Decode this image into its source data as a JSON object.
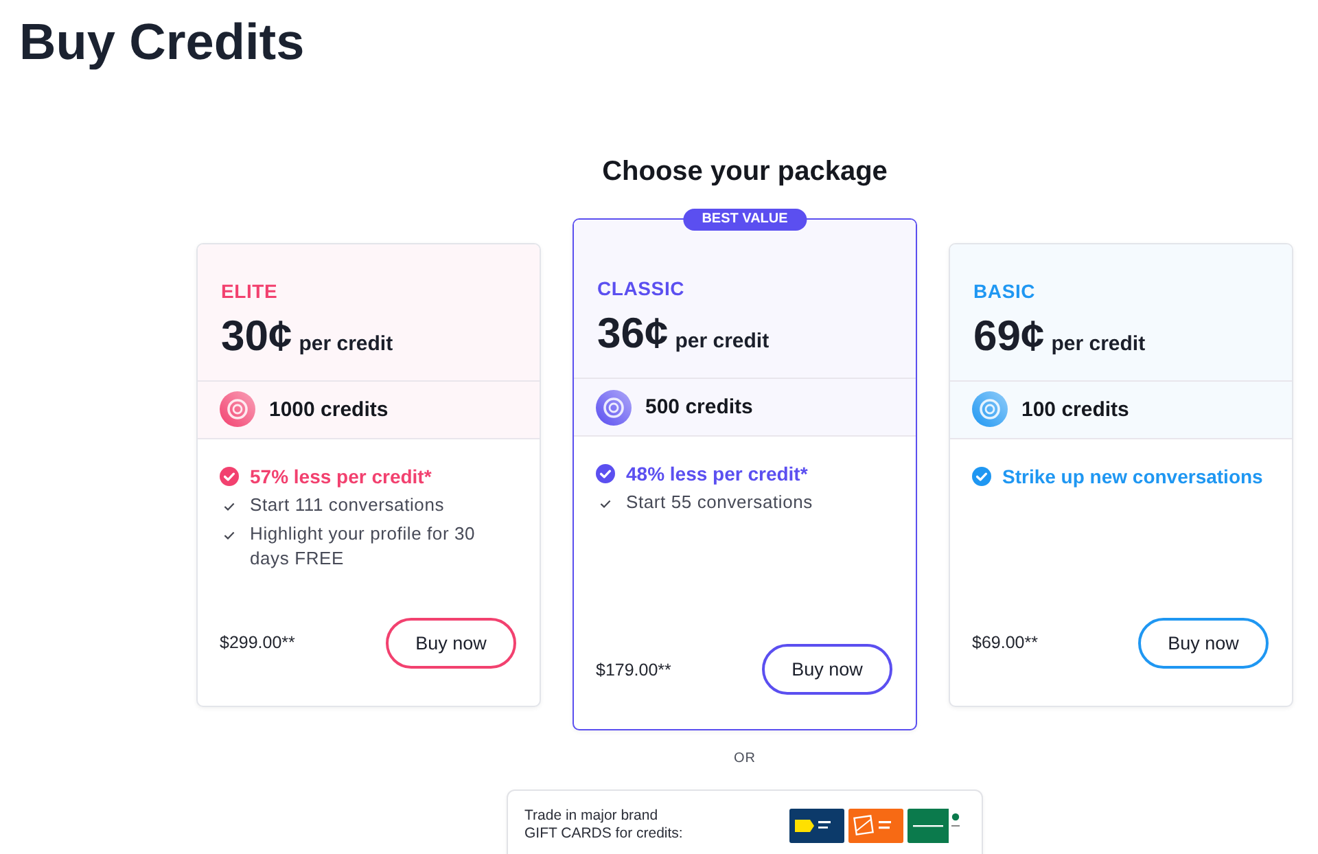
{
  "page": {
    "title": "Buy Credits"
  },
  "heading": "Choose your package",
  "packages": [
    {
      "name": "ELITE",
      "color": "#f2416f",
      "featured": false,
      "price": "30¢",
      "unit": "per credit",
      "credits": "1000 credits",
      "features": [
        {
          "kind": "highlight",
          "text": "57% less per credit*"
        },
        {
          "kind": "plain",
          "text": "Start 111 conversations"
        },
        {
          "kind": "plain",
          "text": "Highlight your profile for 30 days FREE"
        }
      ],
      "total": "$299.00**",
      "button": "Buy now"
    },
    {
      "name": "CLASSIC",
      "color": "#5b4ff0",
      "featured": true,
      "badge": "BEST VALUE",
      "price": "36¢",
      "unit": "per credit",
      "credits": "500 credits",
      "features": [
        {
          "kind": "highlight",
          "text": "48% less per credit*"
        },
        {
          "kind": "plain",
          "text": "Start 55 conversations"
        }
      ],
      "total": "$179.00**",
      "button": "Buy now"
    },
    {
      "name": "BASIC",
      "color": "#1f97f2",
      "featured": false,
      "price": "69¢",
      "unit": "per credit",
      "credits": "100 credits",
      "features": [
        {
          "kind": "highlight",
          "text": "Strike up new conversations"
        }
      ],
      "total": "$69.00**",
      "button": "Buy now"
    }
  ],
  "separator": "OR",
  "gift_cards": {
    "lines": [
      "Trade in major brand",
      "GIFT CARDS for credits:"
    ],
    "cards": [
      {
        "color": "#0c3a6a"
      },
      {
        "color": "#f76a14"
      },
      {
        "color": "#0b7a4c"
      }
    ]
  }
}
